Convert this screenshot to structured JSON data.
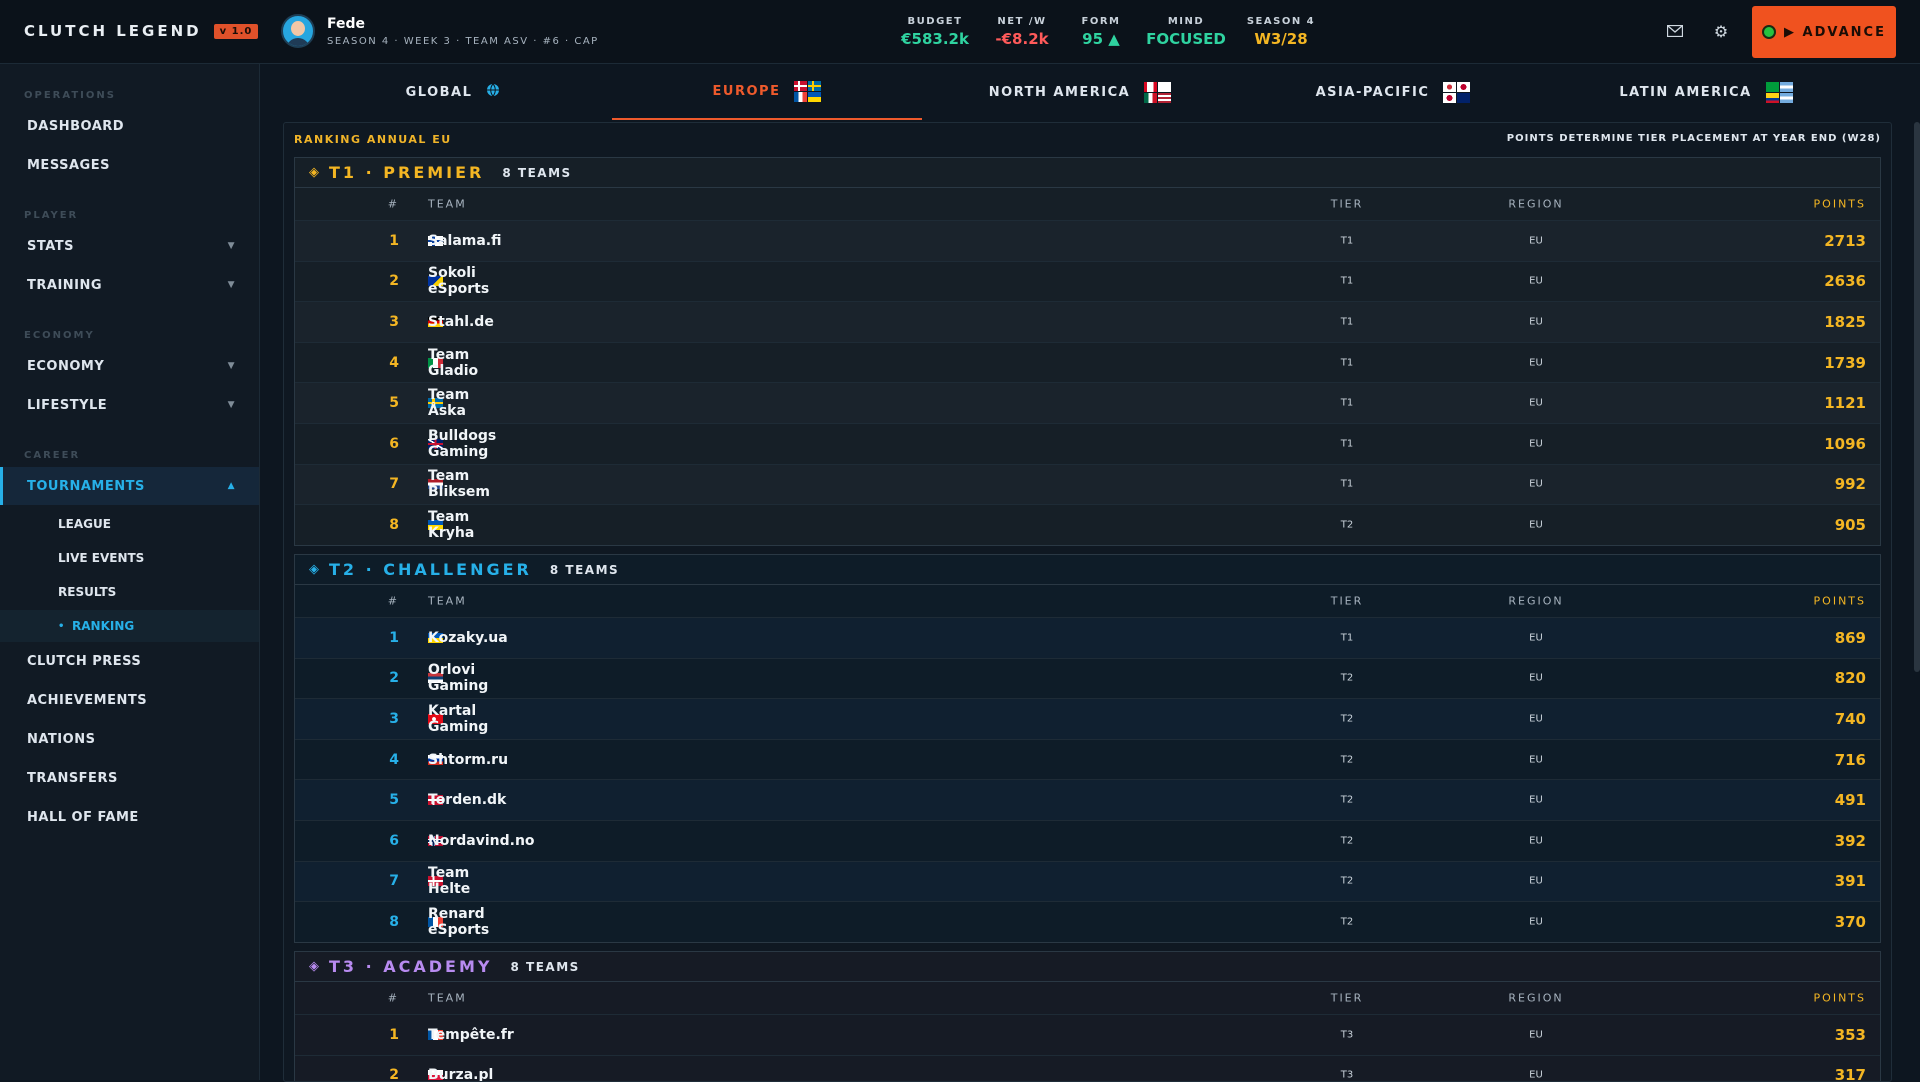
{
  "app": {
    "name": "CLUTCH LEGEND",
    "version": "v 1.0"
  },
  "player": {
    "name": "Fede",
    "subtitle": "SEASON 4 · WEEK 3 · TEAM ASV · #6 · CAP"
  },
  "stats": [
    {
      "label": "BUDGET",
      "value": "€583.2k",
      "color": "#2fd3a0"
    },
    {
      "label": "NET /W",
      "value": "-€8.2k",
      "color": "#ff5a5a"
    },
    {
      "label": "FORM",
      "value": "95 ▲",
      "color": "#2fd3a0"
    },
    {
      "label": "MIND",
      "value": "FOCUSED",
      "color": "#2fd3a0"
    },
    {
      "label": "SEASON 4",
      "value": "W3/28",
      "color": "#f4b623"
    }
  ],
  "advance_label": "▶ ADVANCE",
  "sidebar": {
    "sections": [
      "OPERATIONS",
      "PLAYER",
      "ECONOMY",
      "CAREER"
    ],
    "items": [
      {
        "label": "DASHBOARD"
      },
      {
        "label": "MESSAGES"
      },
      {
        "label": "STATS",
        "arrow": "▼"
      },
      {
        "label": "TRAINING",
        "arrow": "▼"
      },
      {
        "label": "ECONOMY",
        "arrow": "▼"
      },
      {
        "label": "LIFESTYLE",
        "arrow": "▼"
      },
      {
        "label": "TOURNAMENTS",
        "arrow": "▲"
      },
      {
        "label": "CLUTCH PRESS"
      },
      {
        "label": "ACHIEVEMENTS"
      },
      {
        "label": "NATIONS"
      },
      {
        "label": "TRANSFERS"
      },
      {
        "label": "HALL OF FAME"
      }
    ],
    "subitems": [
      {
        "label": "LEAGUE"
      },
      {
        "label": "LIVE EVENTS"
      },
      {
        "label": "RESULTS"
      },
      {
        "label": "RANKING",
        "dot": "•"
      }
    ]
  },
  "tabs": [
    {
      "label": "GLOBAL",
      "icon": "globe-icon"
    },
    {
      "label": "EUROPE",
      "active": true
    },
    {
      "label": "NORTH AMERICA"
    },
    {
      "label": "ASIA-PACIFIC"
    },
    {
      "label": "LATIN AMERICA"
    }
  ],
  "panel": {
    "title": "RANKING ANNUAL EU",
    "note": "POINTS DETERMINE TIER PLACEMENT AT YEAR END (W28)"
  },
  "columns": {
    "num": "#",
    "team": "TEAM",
    "tier": "TIER",
    "region": "REGION",
    "points": "POINTS"
  },
  "groups": [
    {
      "icon": "◈",
      "title": "T1 · PREMIER",
      "count": "8 TEAMS",
      "color": "#f4b623",
      "rows": [
        {
          "rank": "1",
          "team": "Salama.fi",
          "flag": "fi",
          "tier": "T1",
          "region": "EU",
          "points": "2713"
        },
        {
          "rank": "2",
          "team": "Sokoli eSports",
          "flag": "ba",
          "tier": "T1",
          "region": "EU",
          "points": "2636"
        },
        {
          "rank": "3",
          "team": "Stahl.de",
          "flag": "de",
          "tier": "T1",
          "region": "EU",
          "points": "1825"
        },
        {
          "rank": "4",
          "team": "Team Gladio",
          "flag": "it",
          "tier": "T1",
          "region": "EU",
          "points": "1739"
        },
        {
          "rank": "5",
          "team": "Team Åska",
          "flag": "se",
          "tier": "T1",
          "region": "EU",
          "points": "1121"
        },
        {
          "rank": "6",
          "team": "Bulldogs Gaming",
          "flag": "gb",
          "tier": "T1",
          "region": "EU",
          "points": "1096"
        },
        {
          "rank": "7",
          "team": "Team Bliksem",
          "flag": "nl",
          "tier": "T1",
          "region": "EU",
          "points": "992"
        },
        {
          "rank": "8",
          "team": "Team Kryha",
          "flag": "ua",
          "tier": "T2",
          "region": "EU",
          "points": "905"
        }
      ]
    },
    {
      "icon": "◈",
      "title": "T2 · CHALLENGER",
      "count": "8 TEAMS",
      "color": "#27b0e8",
      "rows": [
        {
          "rank": "1",
          "team": "Kozaky.ua",
          "flag": "ua",
          "tier": "T1",
          "region": "EU",
          "points": "869"
        },
        {
          "rank": "2",
          "team": "Orlovi Gaming",
          "flag": "rs",
          "tier": "T2",
          "region": "EU",
          "points": "820"
        },
        {
          "rank": "3",
          "team": "Kartal Gaming",
          "flag": "tr",
          "tier": "T2",
          "region": "EU",
          "points": "740"
        },
        {
          "rank": "4",
          "team": "Shtorm.ru",
          "flag": "ru",
          "tier": "T2",
          "region": "EU",
          "points": "716"
        },
        {
          "rank": "5",
          "team": "Torden.dk",
          "flag": "dk",
          "tier": "T2",
          "region": "EU",
          "points": "491"
        },
        {
          "rank": "6",
          "team": "Nordavind.no",
          "flag": "no",
          "tier": "T2",
          "region": "EU",
          "points": "392"
        },
        {
          "rank": "7",
          "team": "Team Helte",
          "flag": "dk",
          "tier": "T2",
          "region": "EU",
          "points": "391"
        },
        {
          "rank": "8",
          "team": "Renard eSports",
          "flag": "fr",
          "tier": "T2",
          "region": "EU",
          "points": "370"
        }
      ]
    },
    {
      "icon": "◈",
      "title": "T3 · ACADEMY",
      "count": "8 TEAMS",
      "color": "#b88bf0",
      "rows": [
        {
          "rank": "1",
          "team": "Tempête.fr",
          "flag": "fr",
          "tier": "T3",
          "region": "EU",
          "points": "353"
        },
        {
          "rank": "2",
          "team": "Burza.pl",
          "flag": "pl",
          "tier": "T3",
          "region": "EU",
          "points": "317"
        }
      ]
    }
  ]
}
